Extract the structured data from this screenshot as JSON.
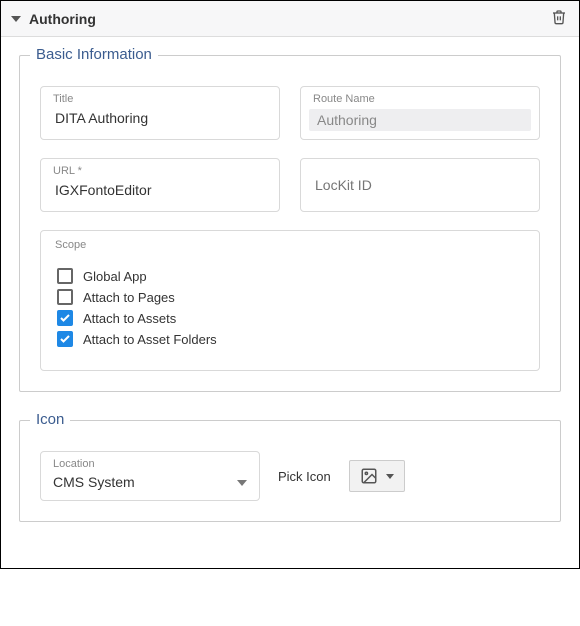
{
  "header": {
    "title": "Authoring"
  },
  "basic": {
    "legend": "Basic Information",
    "title_label": "Title",
    "title_value": "DITA Authoring",
    "route_label": "Route Name",
    "route_value": "Authoring",
    "url_label": "URL *",
    "url_value": "IGXFontoEditor",
    "lockit_placeholder": "LocKit ID",
    "scope_label": "Scope",
    "scope": [
      {
        "label": "Global App",
        "checked": false
      },
      {
        "label": "Attach to Pages",
        "checked": false
      },
      {
        "label": "Attach to Assets",
        "checked": true
      },
      {
        "label": "Attach to Asset Folders",
        "checked": true
      }
    ]
  },
  "icon": {
    "legend": "Icon",
    "location_label": "Location",
    "location_value": "CMS System",
    "pick_label": "Pick Icon"
  }
}
